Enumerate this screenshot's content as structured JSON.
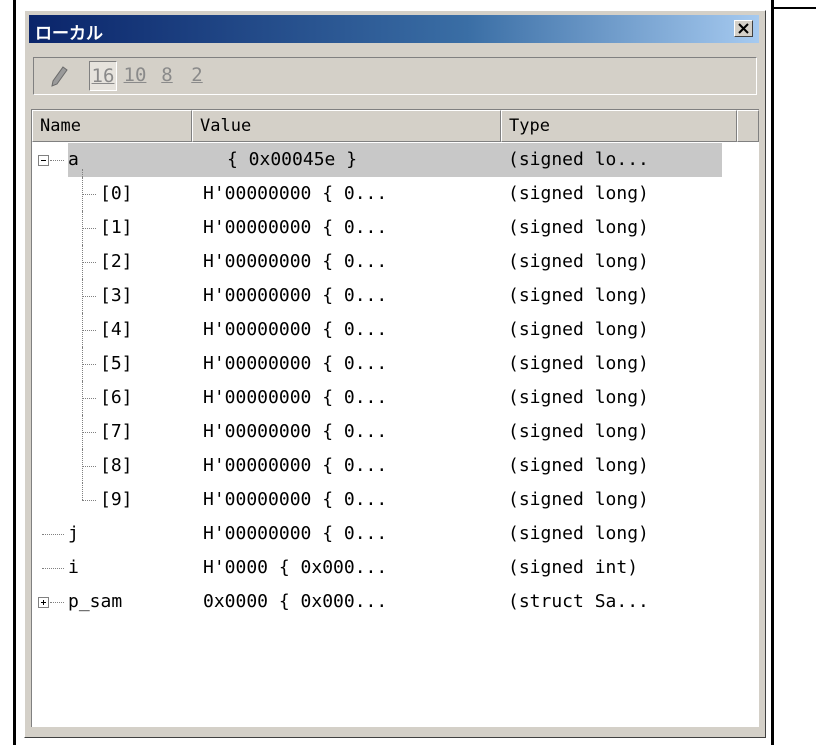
{
  "window": {
    "title": "ローカル"
  },
  "toolbar": {
    "radix_buttons": [
      {
        "label": "16",
        "pressed": true
      },
      {
        "label": "10",
        "pressed": false
      },
      {
        "label": "8",
        "pressed": false
      },
      {
        "label": "2",
        "pressed": false
      }
    ],
    "icons": {
      "edit": "pencil-icon",
      "close": "close-icon"
    }
  },
  "columns": [
    "Name",
    "Value",
    "Type"
  ],
  "rows": [
    {
      "name": "a",
      "value": "{ 0x00045e }",
      "type": "(signed lo...",
      "expander": "minus",
      "level": 0,
      "selected": true
    },
    {
      "name": "[0]",
      "value": "H'00000000 { 0...",
      "type": "(signed long)",
      "level": 1
    },
    {
      "name": "[1]",
      "value": "H'00000000 { 0...",
      "type": "(signed long)",
      "level": 1
    },
    {
      "name": "[2]",
      "value": "H'00000000 { 0...",
      "type": "(signed long)",
      "level": 1
    },
    {
      "name": "[3]",
      "value": "H'00000000 { 0...",
      "type": "(signed long)",
      "level": 1
    },
    {
      "name": "[4]",
      "value": "H'00000000 { 0...",
      "type": "(signed long)",
      "level": 1
    },
    {
      "name": "[5]",
      "value": "H'00000000 { 0...",
      "type": "(signed long)",
      "level": 1
    },
    {
      "name": "[6]",
      "value": "H'00000000 { 0...",
      "type": "(signed long)",
      "level": 1
    },
    {
      "name": "[7]",
      "value": "H'00000000 { 0...",
      "type": "(signed long)",
      "level": 1
    },
    {
      "name": "[8]",
      "value": "H'00000000 { 0...",
      "type": "(signed long)",
      "level": 1
    },
    {
      "name": "[9]",
      "value": "H'00000000 { 0...",
      "type": "(signed long)",
      "level": 1
    },
    {
      "name": "j",
      "value": "H'00000000 { 0...",
      "type": "(signed long)",
      "level": 0
    },
    {
      "name": "i",
      "value": "H'0000 { 0x000...",
      "type": "(signed int)",
      "level": 0
    },
    {
      "name": "p_sam",
      "value": "0x0000 { 0x000...",
      "type": "(struct Sa...",
      "expander": "plus",
      "level": 0
    }
  ]
}
